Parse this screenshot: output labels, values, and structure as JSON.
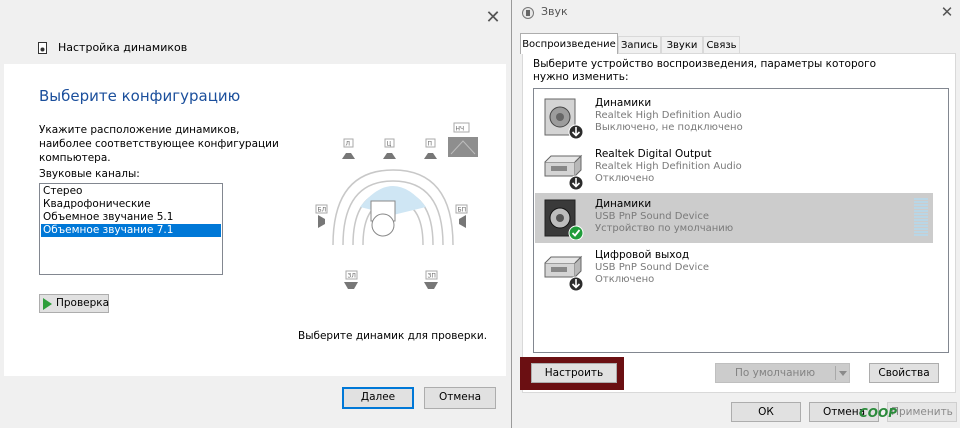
{
  "left_window": {
    "header_title": "Настройка динамиков",
    "heading": "Выберите конфигурацию",
    "description": "Укажите расположение динамиков, наиболее соответствующее конфигурации компьютера.",
    "channels_label": "Звуковые каналы:",
    "channels": [
      "Стерео",
      "Квадрофонические",
      "Объемное звучание 5.1",
      "Объемное звучание 7.1"
    ],
    "selected_channel": "Объемное звучание 7.1",
    "test_button": "Проверка",
    "hint": "Выберите динамик для проверки.",
    "next_button": "Далее",
    "cancel_button": "Отмена",
    "diagram": {
      "front_left": "Л",
      "center": "Ц",
      "front_right": "П",
      "subwoofer": "НЧ",
      "side_left": "БЛ",
      "side_right": "БП",
      "rear_left": "ЗЛ",
      "rear_right": "ЗП"
    }
  },
  "right_window": {
    "title": "Звук",
    "tabs": [
      "Воспроизведение",
      "Запись",
      "Звуки",
      "Связь"
    ],
    "active_tab": "Воспроизведение",
    "instruction": "Выберите устройство воспроизведения, параметры которого нужно изменить:",
    "devices": [
      {
        "name": "Динамики",
        "driver": "Realtek High Definition Audio",
        "status": "Выключено, не подключено",
        "icon": "speaker-icon",
        "badge": "down-arrow-icon",
        "selected": false
      },
      {
        "name": "Realtek Digital Output",
        "driver": "Realtek High Definition Audio",
        "status": "Отключено",
        "icon": "digital-output-icon",
        "badge": "down-arrow-icon",
        "selected": false
      },
      {
        "name": "Динамики",
        "driver": "USB PnP Sound Device",
        "status": "Устройство по умолчанию",
        "icon": "speaker-icon",
        "badge": "checkmark-icon",
        "selected": true
      },
      {
        "name": "Цифровой выход",
        "driver": "USB PnP Sound Device",
        "status": "Отключено",
        "icon": "digital-output-icon",
        "badge": "down-arrow-icon",
        "selected": false
      }
    ],
    "configure_button": "Настроить",
    "default_button": "По умолчанию",
    "properties_button": "Свойства",
    "ok_button": "ОК",
    "cancel_button": "Отмена",
    "apply_button": "Применить",
    "watermark": "COOP"
  }
}
